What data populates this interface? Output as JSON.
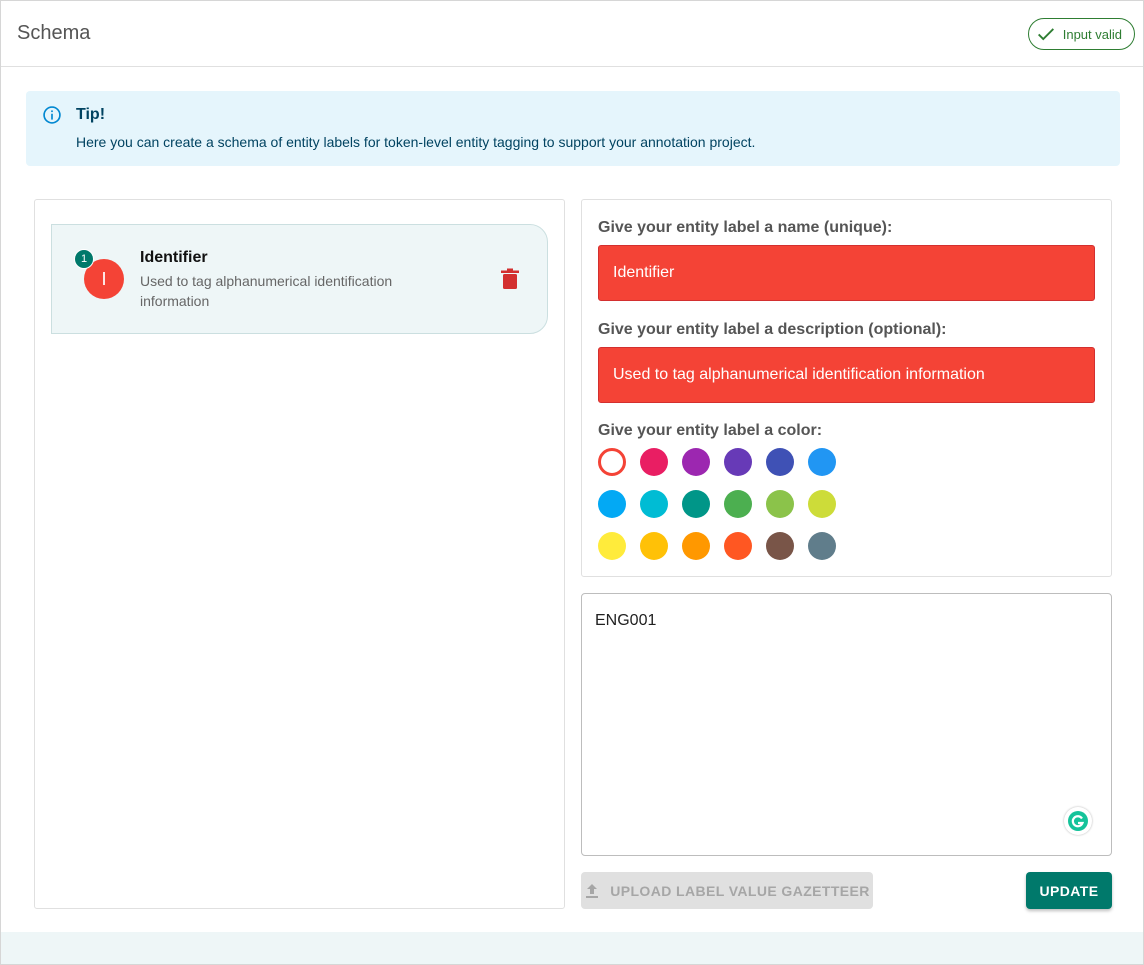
{
  "header": {
    "title": "Schema",
    "status_label": "Input valid",
    "status_icon": "check-icon",
    "status_color": "#2e7d32"
  },
  "tip": {
    "icon": "info-icon",
    "title": "Tip!",
    "text": "Here you can create a schema of entity labels for token-level entity tagging to support your annotation project."
  },
  "labels": [
    {
      "index": "1",
      "avatar_letter": "I",
      "name": "Identifier",
      "description": "Used to tag alphanumerical identification information",
      "color": "#f44336"
    }
  ],
  "form": {
    "name_label": "Give your entity label a name (unique):",
    "name_value": "Identifier",
    "description_label": "Give your entity label a description (optional):",
    "description_value": "Used to tag alphanumerical identification information",
    "color_label": "Give your entity label a color:",
    "selected_color": "#f44336",
    "colors": [
      "#f44336",
      "#e91e63",
      "#9c27b0",
      "#673ab7",
      "#3f51b5",
      "#2196f3",
      "#03a9f4",
      "#00bcd4",
      "#009688",
      "#4caf50",
      "#8bc34a",
      "#cddc39",
      "#ffeb3b",
      "#ffc107",
      "#ff9800",
      "#ff5722",
      "#795548",
      "#607d8b"
    ]
  },
  "gazetteer": {
    "text": "ENG001"
  },
  "actions": {
    "upload_label": "UPLOAD LABEL VALUE GAZETTEER",
    "update_label": "UPDATE"
  }
}
